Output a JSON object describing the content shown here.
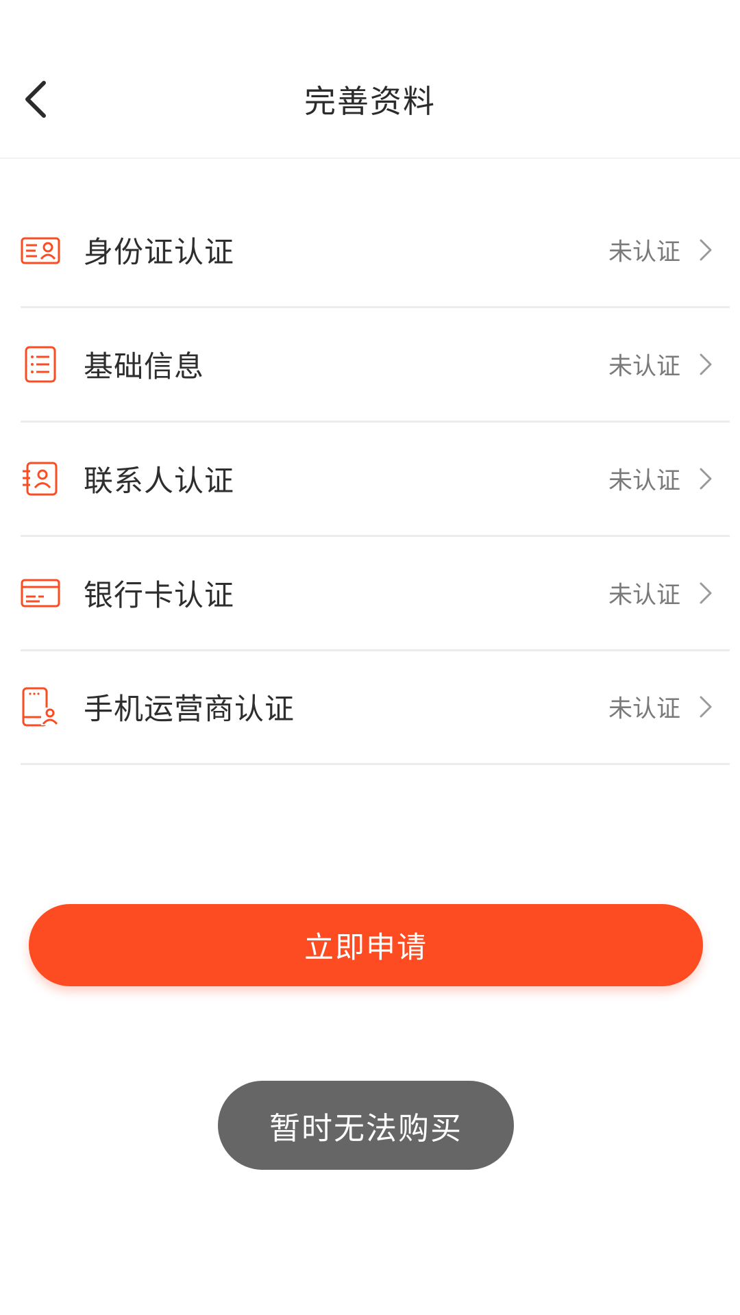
{
  "header": {
    "title": "完善资料",
    "back_icon": "chevron-left-icon"
  },
  "colors": {
    "accent": "#fd4c22",
    "toast_bg": "#666666",
    "status_text": "#7a7a7a"
  },
  "verification_items": [
    {
      "label": "身份证认证",
      "status": "未认证",
      "icon": "id-card-icon"
    },
    {
      "label": "基础信息",
      "status": "未认证",
      "icon": "list-document-icon"
    },
    {
      "label": "联系人认证",
      "status": "未认证",
      "icon": "contact-card-icon"
    },
    {
      "label": "银行卡认证",
      "status": "未认证",
      "icon": "bank-card-icon"
    },
    {
      "label": "手机运营商认证",
      "status": "未认证",
      "icon": "mobile-user-icon"
    }
  ],
  "apply_button": {
    "label": "立即申请"
  },
  "toast": {
    "message": "暂时无法购买"
  }
}
